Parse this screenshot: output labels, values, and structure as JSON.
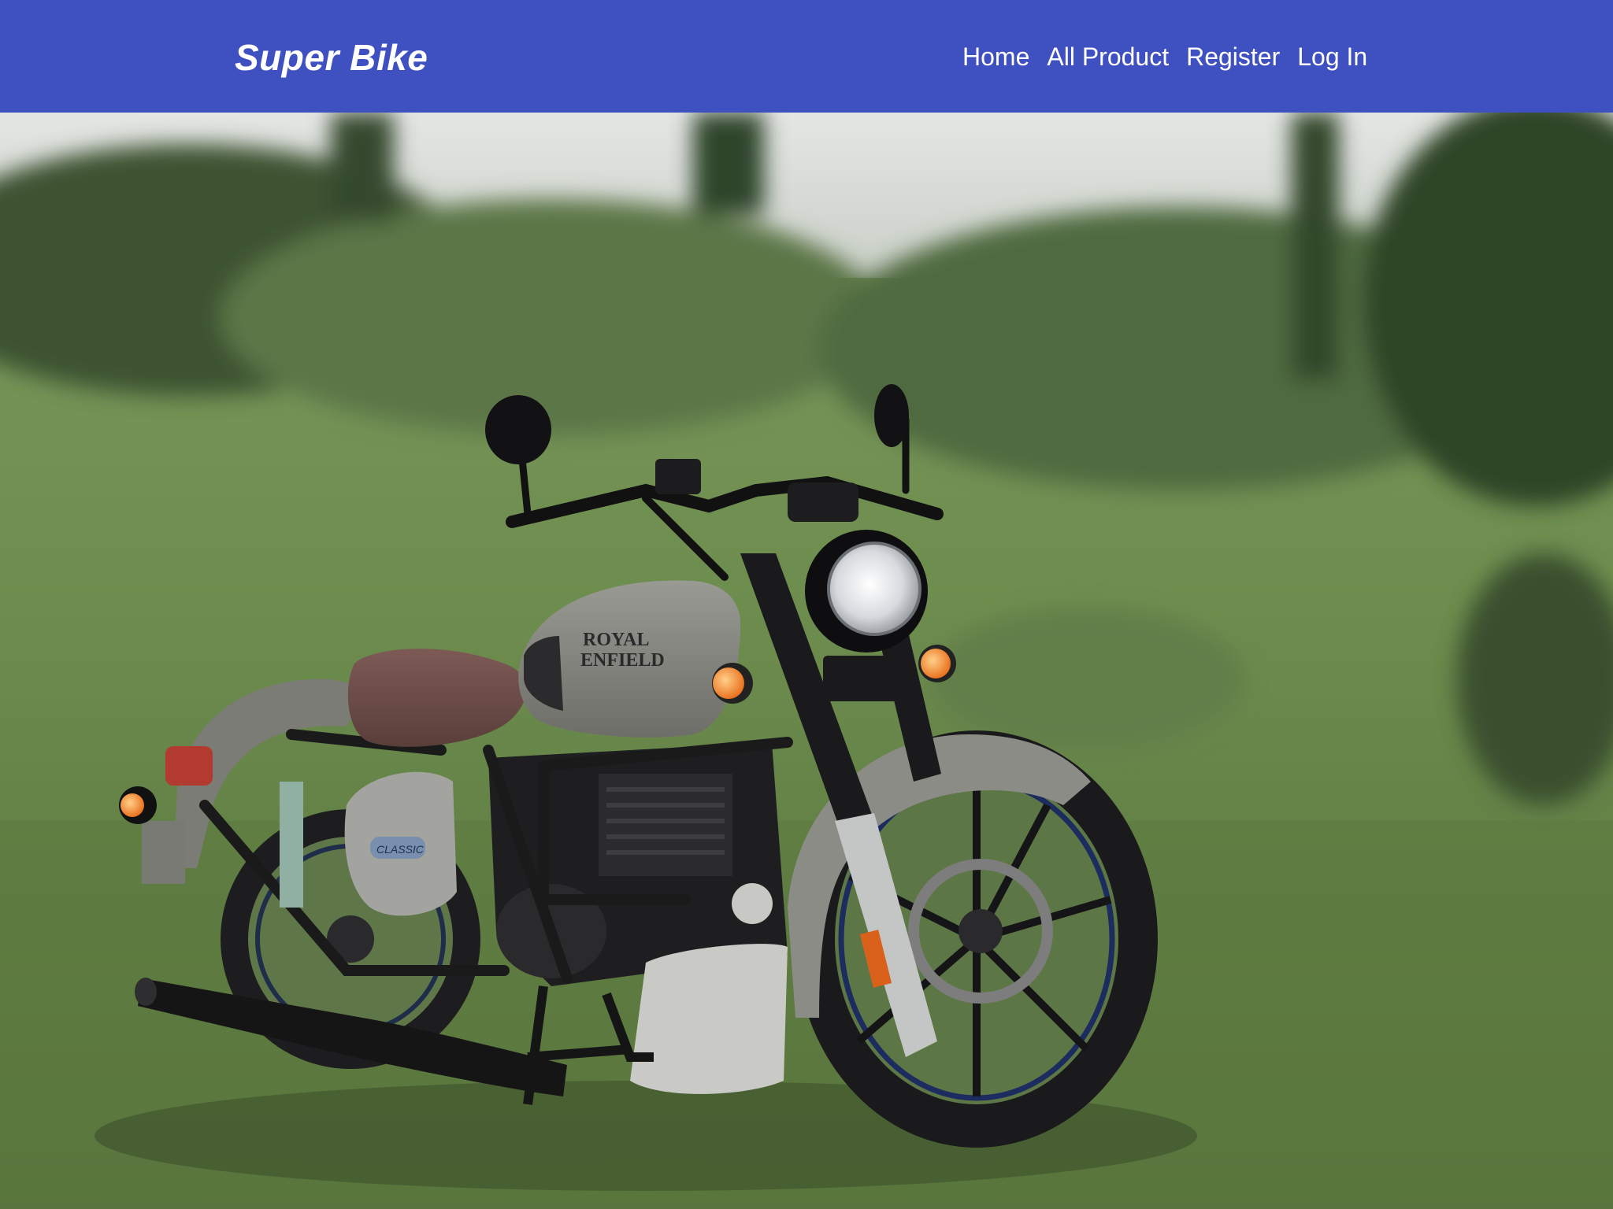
{
  "navbar": {
    "brand": "Super Bike",
    "links": [
      {
        "label": "Home"
      },
      {
        "label": "All Product"
      },
      {
        "label": "Register"
      },
      {
        "label": "Log In"
      }
    ]
  },
  "hero": {
    "image_subject": "motorcycle-photo",
    "tank_brand_line1": "ROYAL",
    "tank_brand_line2": "ENFIELD",
    "side_badge": "CLASSIC"
  },
  "colors": {
    "navbar_bg": "#3f51c1",
    "nav_text": "#ffffff"
  }
}
